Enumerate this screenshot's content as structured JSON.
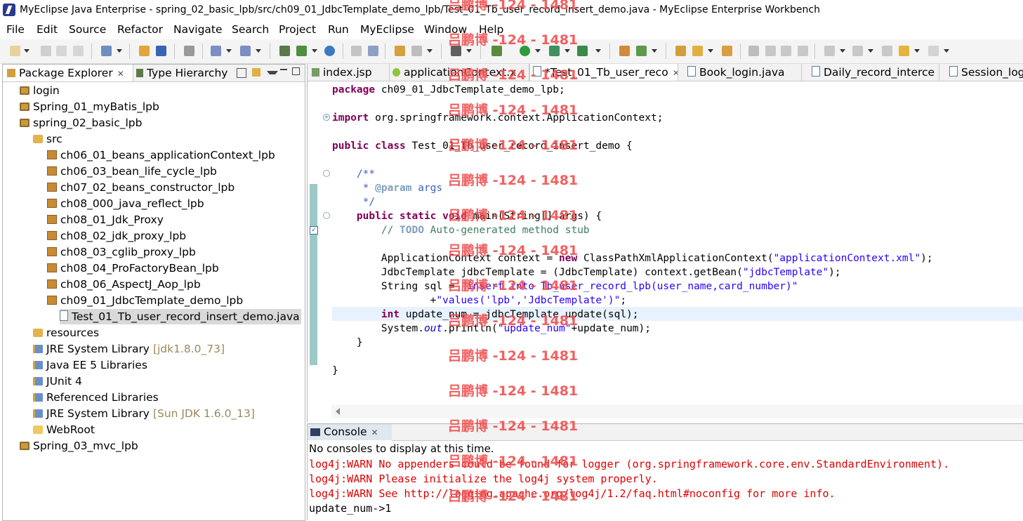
{
  "window": {
    "title": "MyEclipse Java Enterprise - spring_02_basic_lpb/src/ch09_01_JdbcTemplate_demo_lpb/Test_01_Tb_user_record_insert_demo.java - MyEclipse Enterprise Workbench"
  },
  "menu": [
    "File",
    "Edit",
    "Source",
    "Refactor",
    "Navigate",
    "Search",
    "Project",
    "Run",
    "MyEclipse",
    "Window",
    "Help"
  ],
  "left_tabs": {
    "package_explorer": "Package Explorer",
    "type_hierarchy": "Type Hierarchy"
  },
  "tree": [
    {
      "label": "login",
      "icon": "project-icon"
    },
    {
      "label": "Spring_01_myBatis_lpb",
      "icon": "project-icon"
    },
    {
      "label": "spring_02_basic_lpb",
      "icon": "project-icon"
    },
    {
      "label": "src",
      "icon": "source-folder-icon"
    },
    {
      "label": "ch06_01_beans_applicationContext_lpb",
      "icon": "package-icon"
    },
    {
      "label": "ch06_03_bean_life_cycle_lpb",
      "icon": "package-icon"
    },
    {
      "label": "ch07_02_beans_constructor_lpb",
      "icon": "package-icon"
    },
    {
      "label": "ch08_000_java_reflect_lpb",
      "icon": "package-icon"
    },
    {
      "label": "ch08_01_Jdk_Proxy",
      "icon": "package-icon"
    },
    {
      "label": "ch08_02_jdk_proxy_lpb",
      "icon": "package-icon"
    },
    {
      "label": "ch08_03_cglib_proxy_lpb",
      "icon": "package-icon"
    },
    {
      "label": "ch08_04_ProFactoryBean_lpb",
      "icon": "package-icon"
    },
    {
      "label": "ch08_06_AspectJ_Aop_lpb",
      "icon": "package-icon"
    },
    {
      "label": "ch09_01_JdbcTemplate_demo_lpb",
      "icon": "package-icon"
    },
    {
      "label": "Test_01_Tb_user_record_insert_demo.java",
      "icon": "java-file-icon"
    },
    {
      "label": "resources",
      "icon": "source-folder-icon"
    },
    {
      "label": "JRE System Library",
      "suffix": "[jdk1.8.0_73]",
      "icon": "library-icon"
    },
    {
      "label": "Java EE 5 Libraries",
      "icon": "library-icon"
    },
    {
      "label": "JUnit 4",
      "icon": "library-icon"
    },
    {
      "label": "Referenced Libraries",
      "icon": "library-icon"
    },
    {
      "label": "JRE System Library",
      "suffix": "[Sun JDK 1.6.0_13]",
      "icon": "library-icon"
    },
    {
      "label": "WebRoot",
      "icon": "folder-icon"
    },
    {
      "label": "Spring_03_mvc_lpb",
      "icon": "project-icon"
    }
  ],
  "editor_tabs": [
    "index.jsp",
    "applicationContext.x",
    "*Test_01_Tb_user_reco",
    "Book_login.java",
    "Daily_record_interce",
    "Session_login"
  ],
  "code": {
    "l1_kw": "package",
    "l1_rest": " ch09_01_JdbcTemplate_demo_lpb;",
    "l2_kw": "import",
    "l2_rest": " org.springframework.context.ApplicationContext;",
    "l3_kw1": "public",
    "l3_kw2": "class",
    "l3_rest": " Test_01_Tb_user_record_insert_demo {",
    "l4": "    /**",
    "l5_pre": "     * ",
    "l5_tag": "@param",
    "l5_rest": " args",
    "l6": "     */",
    "l7_pre": "    ",
    "l7_kw": "public static void",
    "l7_rest": " main(String[] args) {",
    "l8_pre": "        // ",
    "l8_todo": "TODO",
    "l8_rest": " Auto-generated method stub",
    "l9_pre": "        ApplicationContext context = ",
    "l9_kw": "new",
    "l9_mid": " ClassPathXmlApplicationContext(",
    "l9_str": "\"applicationContext.xml\"",
    "l9_end": ");",
    "l10_pre": "        JdbcTemplate jdbcTemplate = (JdbcTemplate) context.getBean(",
    "l10_str": "\"jdbcTemplate\"",
    "l10_end": ");",
    "l11_pre": "        String sql = ",
    "l11_str": "\"insert into Tb_user_record_lpb(user_name,card_number)\"",
    "l12_pre": "                +",
    "l12_str": "\"values('lpb','JdbcTemplate')\"",
    "l12_end": ";",
    "l13_pre": "        ",
    "l13_kw": "int",
    "l13_rest": " update_num = jdbcTemplate.update(sql);",
    "l14_pre": "        System.",
    "l14_ital": "out",
    "l14_mid": ".println(",
    "l14_str": "\"update_num\"",
    "l14_end": "+update_num);",
    "l15": "    }",
    "l16": "}"
  },
  "console": {
    "tab": "Console",
    "no_consoles": "No consoles to display at this time.",
    "lines": [
      "log4j:WARN No appenders could be found for logger (org.springframework.core.env.StandardEnvironment).",
      "log4j:WARN Please initialize the log4j system properly.",
      "log4j:WARN See http://logging.apache.org/log4j/1.2/faq.html#noconfig for more info."
    ],
    "output": "update_num->1"
  },
  "watermark": "吕鹏博 -124 - 1481"
}
